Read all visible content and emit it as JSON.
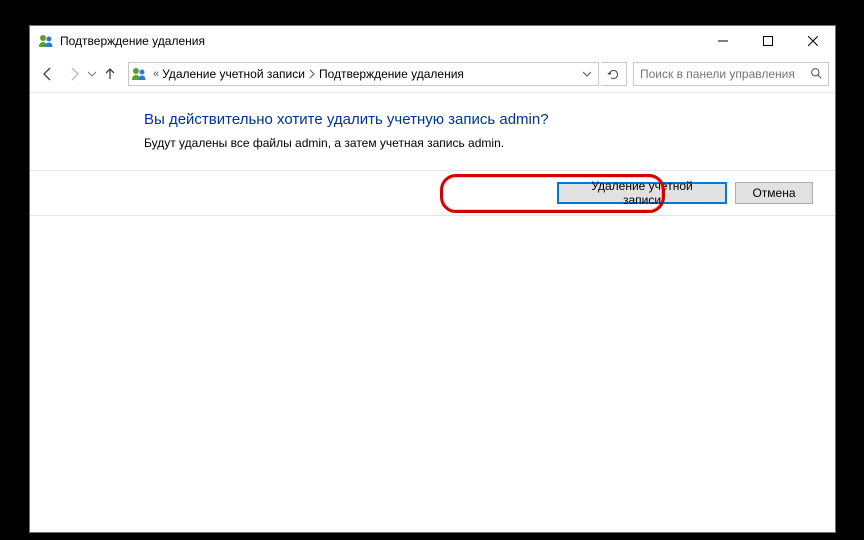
{
  "titlebar": {
    "title": "Подтверждение удаления"
  },
  "breadcrumb": {
    "item1": "Удаление учетной записи",
    "item2": "Подтверждение удаления"
  },
  "search": {
    "placeholder": "Поиск в панели управления"
  },
  "content": {
    "heading": "Вы действительно хотите удалить учетную запись admin?",
    "subtext": "Будут удалены все файлы admin, а затем учетная запись admin."
  },
  "buttons": {
    "delete": "Удаление учетной записи",
    "cancel": "Отмена"
  }
}
